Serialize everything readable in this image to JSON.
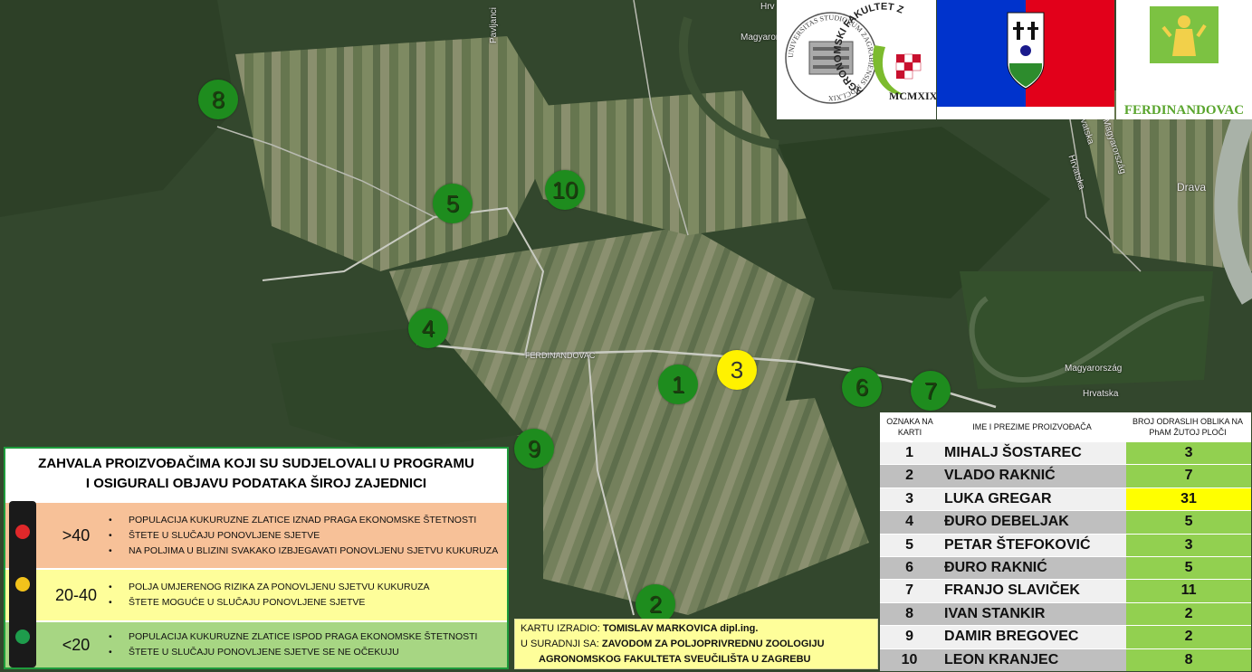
{
  "map": {
    "town_label": "FERDINANDOVAC",
    "road_labels": [
      "Pavljanci",
      "Magyarország",
      "Hrvatska",
      "Magyarország",
      "Hrvatska",
      "Hrvatska",
      "Magyarország",
      "Drava",
      "Hrv"
    ],
    "markers": [
      {
        "label": "1",
        "color": "green"
      },
      {
        "label": "2",
        "color": "green"
      },
      {
        "label": "3",
        "color": "yellow"
      },
      {
        "label": "4",
        "color": "green"
      },
      {
        "label": "5",
        "color": "green"
      },
      {
        "label": "6",
        "color": "green"
      },
      {
        "label": "7",
        "color": "green"
      },
      {
        "label": "8",
        "color": "green"
      },
      {
        "label": "9",
        "color": "green"
      },
      {
        "label": "10",
        "color": "green"
      }
    ]
  },
  "logos": {
    "faculty_seal_text": "UNIVERSITAS STUDIORUM ZAGRABIENSIS MDCLXIX",
    "faculty_text": "AGRONOMSKI FAKULTET ZAGREB",
    "faculty_year": "MCMXIX",
    "municipality": "FERDINANDOVAC"
  },
  "legend": {
    "title_line1": "ZAHVALA PROIZVOĐAČIMA KOJI SU SUDJELOVALI U PROGRAMU",
    "title_line2": "I OSIGURALI OBJAVU PODATAKA ŠIROJ ZAJEDNICI",
    "rows": [
      {
        "range": ">40",
        "bullets": [
          "POPULACIJA KUKURUZNE ZLATICE IZNAD PRAGA EKONOMSKE ŠTETNOSTI",
          "ŠTETE U SLUČAJU PONOVLJENE SJETVE",
          "NA POLJIMA U BLIZINI SVAKAKO IZBJEGAVATI PONOVLJENU SJETVU KUKURUZA"
        ]
      },
      {
        "range": "20-40",
        "bullets": [
          "POLJA UMJERENOG RIZIKA ZA PONOVLJENU SJETVU KUKURUZA",
          "ŠTETE MOGUĆE U SLUČAJU PONOVLJENE SJETVE"
        ]
      },
      {
        "range": "<20",
        "bullets": [
          "POPULACIJA KUKURUZNE ZLATICE ISPOD PRAGA EKONOMSKE ŠTETNOSTI",
          "ŠTETE U SLUČAJU PONOVLJENE SJETVE SE NE OČEKUJU"
        ]
      }
    ],
    "colors": {
      "high": "#f7c198",
      "mid": "#fefe9a",
      "low": "#a7d683",
      "red": "#e0282a",
      "yellow": "#f2c21b",
      "green": "#1e9c4c"
    }
  },
  "credits": {
    "line1_prefix": "KARTU IZRADIO: ",
    "line1_name": "TOMISLAV MARKOVICA dipl.ing.",
    "line2_prefix": "U SURADNJI SA: ",
    "line2_org": "ZAVODOM ZA POLJOPRIVREDNU ZOOLOGIJU",
    "line3": "AGRONOMSKOG FAKULTETA SVEUČILIŠTA U ZAGREBU"
  },
  "table": {
    "headers": [
      "OZNAKA NA KARTI",
      "IME I PREZIME PROIZVOĐAČA",
      "BROJ ODRASLIH OBLIKA NA PhAM ŽUTOJ PLOČI"
    ],
    "rows": [
      {
        "id": "1",
        "name": "MIHALJ ŠOSTAREC",
        "count": "3"
      },
      {
        "id": "2",
        "name": "VLADO RAKNIĆ",
        "count": "7"
      },
      {
        "id": "3",
        "name": "LUKA GREGAR",
        "count": "31"
      },
      {
        "id": "4",
        "name": "ĐURO DEBELJAK",
        "count": "5"
      },
      {
        "id": "5",
        "name": "PETAR ŠTEFOKOVIĆ",
        "count": "3"
      },
      {
        "id": "6",
        "name": "ĐURO RAKNIĆ",
        "count": "5"
      },
      {
        "id": "7",
        "name": "FRANJO SLAVIČEK",
        "count": "11"
      },
      {
        "id": "8",
        "name": "IVAN STANKIR",
        "count": "2"
      },
      {
        "id": "9",
        "name": "DAMIR BREGOVEC",
        "count": "2"
      },
      {
        "id": "10",
        "name": "LEON KRANJEC",
        "count": "8"
      }
    ]
  }
}
